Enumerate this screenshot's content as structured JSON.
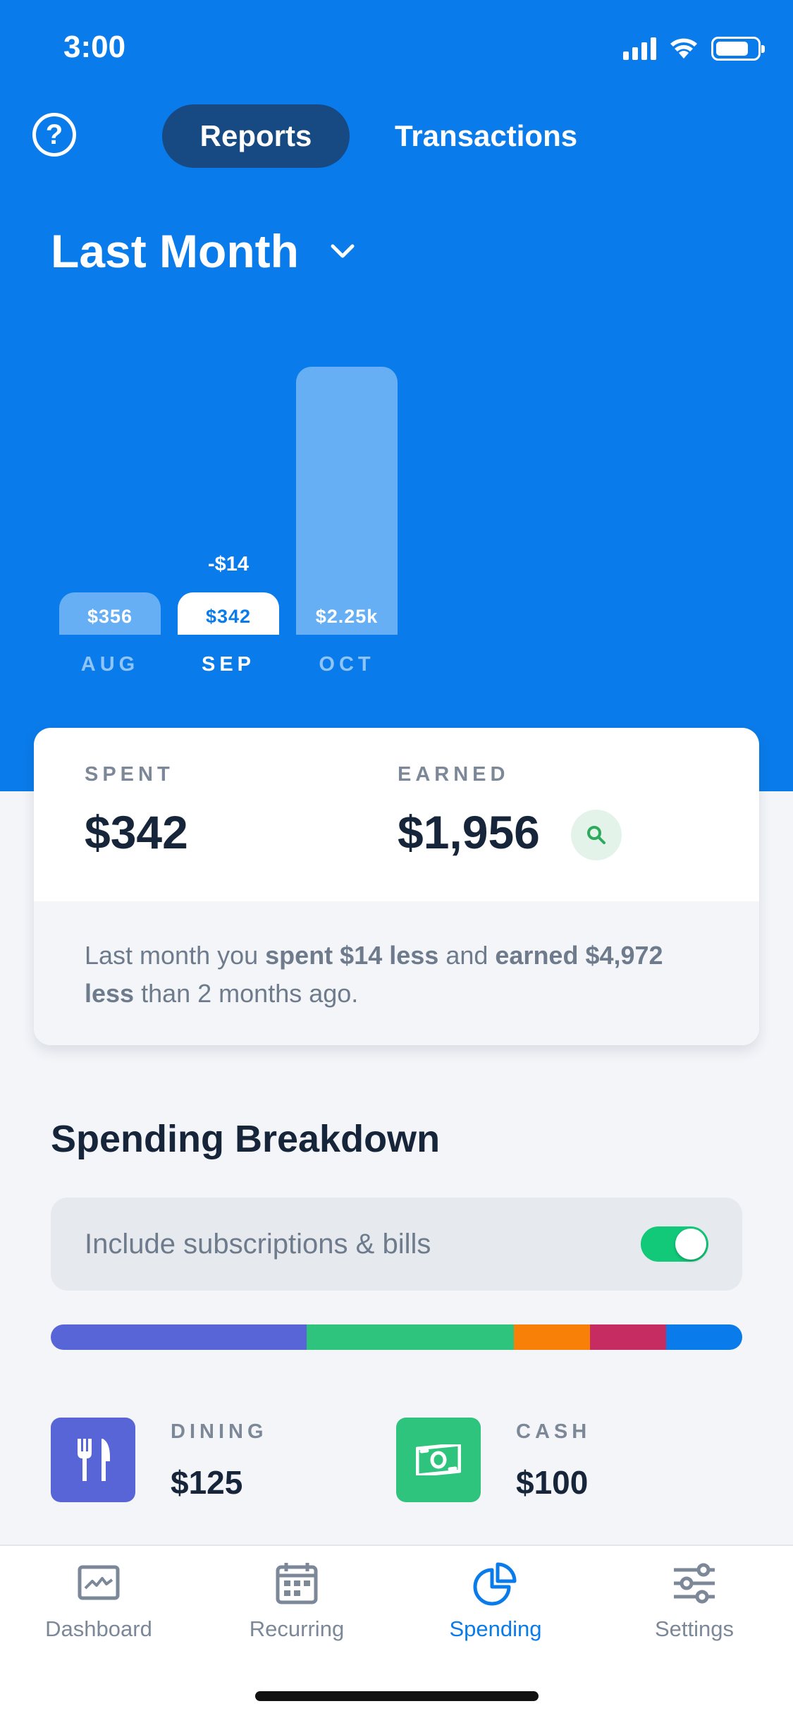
{
  "status": {
    "time": "3:00"
  },
  "nav": {
    "reports_tab": "Reports",
    "transactions_tab": "Transactions"
  },
  "period": {
    "label": "Last Month"
  },
  "chart_data": {
    "type": "bar",
    "categories": [
      "AUG",
      "SEP",
      "OCT"
    ],
    "values": [
      356,
      342,
      2250
    ],
    "value_labels": [
      "$356",
      "$342",
      "$2.25k"
    ],
    "selected_index": 1,
    "annotation": "-$14",
    "colors": {
      "bar": "#66AFF5",
      "selected_bar": "#FFFFFF"
    }
  },
  "summary": {
    "spent_label": "SPENT",
    "spent_value": "$342",
    "earned_label": "EARNED",
    "earned_value": "$1,956",
    "note_parts": [
      "Last month you ",
      "spent $14 less",
      " and ",
      "earned $4,972 less",
      " than 2 months ago."
    ]
  },
  "breakdown": {
    "title": "Spending Breakdown",
    "toggle_label": "Include subscriptions & bills",
    "toggle_on": true,
    "segments": [
      {
        "color": "#5865D6",
        "share": 0.37
      },
      {
        "color": "#2EC47E",
        "share": 0.3
      },
      {
        "color": "#F98008",
        "share": 0.11
      },
      {
        "color": "#C62C62",
        "share": 0.11
      },
      {
        "color": "#0A7BEA",
        "share": 0.11
      }
    ],
    "categories": [
      {
        "name": "DINING",
        "amount": "$125",
        "icon": "fork-knife-icon",
        "color": "#5865D6"
      },
      {
        "name": "CASH",
        "amount": "$100",
        "icon": "cash-icon",
        "color": "#2EC47E"
      }
    ]
  },
  "tabbar": {
    "items": [
      {
        "label": "Dashboard",
        "icon": "dashboard-icon"
      },
      {
        "label": "Recurring",
        "icon": "calendar-icon"
      },
      {
        "label": "Spending",
        "icon": "pie-chart-icon"
      },
      {
        "label": "Settings",
        "icon": "sliders-icon"
      }
    ],
    "active_index": 2,
    "accent": "#0A7BEA"
  }
}
